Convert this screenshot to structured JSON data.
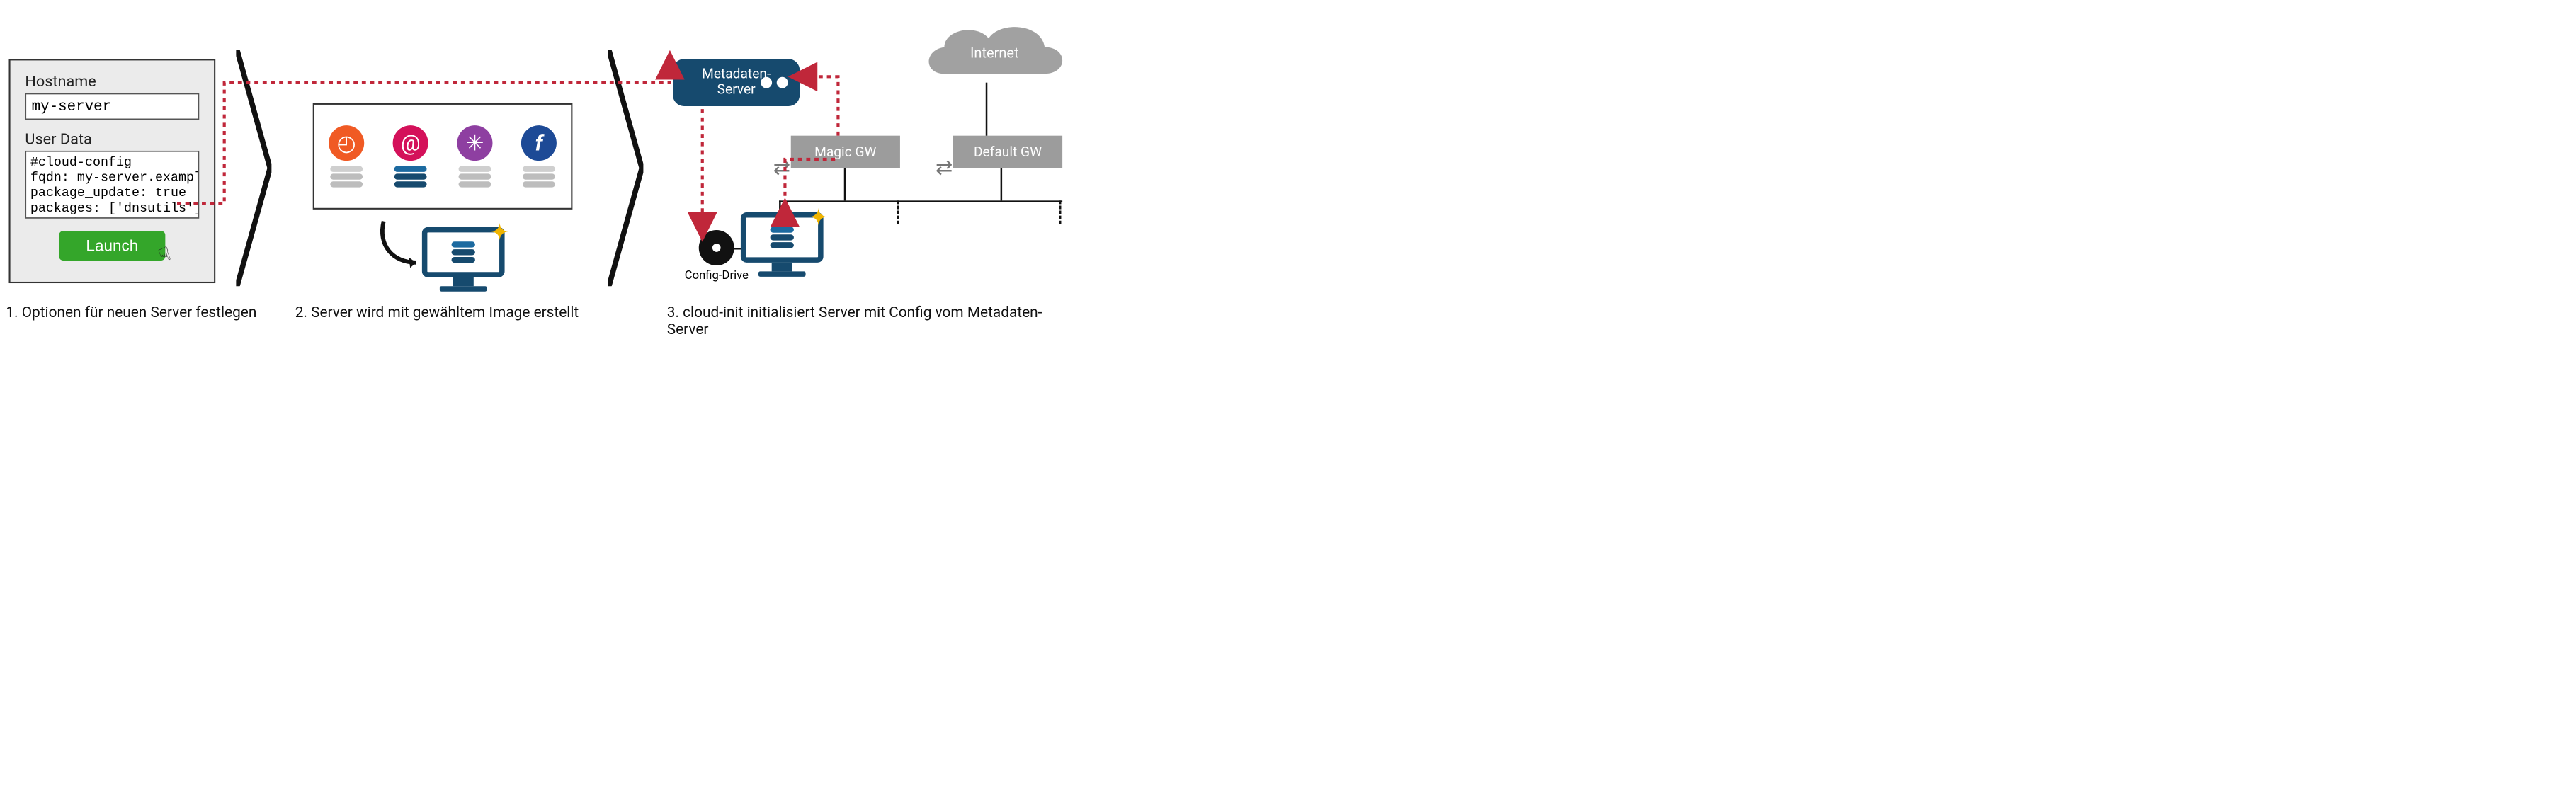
{
  "form": {
    "hostname_label": "Hostname",
    "hostname_value": "my-server",
    "userdata_label": "User Data",
    "userdata_value": "#cloud-config\nfqdn: my-server.example\npackage_update: true\npackages: ['dnsutils']\nruncmd:",
    "launch_label": "Launch"
  },
  "os_logos": [
    {
      "name": "ubuntu",
      "bg": "#f05a24",
      "glyph": "◆"
    },
    {
      "name": "debian",
      "bg": "#d4115a",
      "glyph": "@"
    },
    {
      "name": "centos",
      "bg": "#8e3fa1",
      "glyph": "✳"
    },
    {
      "name": "fedora",
      "bg": "#1d4a96",
      "glyph": "f"
    }
  ],
  "metadata_server": {
    "line1": "Metadaten-",
    "line2": "Server"
  },
  "internet_label": "Internet",
  "magic_gw_label": "Magic GW",
  "default_gw_label": "Default GW",
  "config_drive_label": "Config-Drive",
  "captions": {
    "c1": "1. Optionen für neuen Server festlegen",
    "c2": "2. Server wird mit gewähltem Image erstellt",
    "c3": "3. cloud-init initialisiert Server mit Config vom Metadaten-Server"
  },
  "colors": {
    "brand_blue": "#164a6e",
    "red_dot": "#c0273a",
    "green_btn": "#34a62a",
    "grey_box": "#9c9c9c"
  }
}
